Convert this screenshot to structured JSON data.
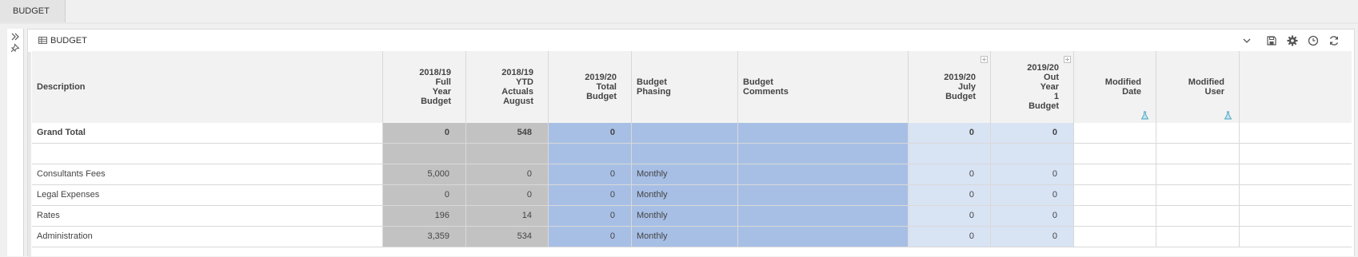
{
  "tab": {
    "label": "BUDGET"
  },
  "panel": {
    "title": "BUDGET"
  },
  "colors": {
    "actuals_bg": "#c2c2c2",
    "phasing_bg": "#a7bfe5",
    "projection_bg": "#d8e3f4",
    "header_bg": "#f2f2f2"
  },
  "columns": [
    {
      "label": "Description"
    },
    {
      "label": "2018/19\nFull\nYear\nBudget"
    },
    {
      "label": "2018/19\nYTD\nActuals\nAugust"
    },
    {
      "label": "2019/20\nTotal\nBudget"
    },
    {
      "label": "Budget\nPhasing"
    },
    {
      "label": "Budget\nComments"
    },
    {
      "label": "2019/20\nJuly\nBudget"
    },
    {
      "label": "2019/20\nOut\nYear\n1\nBudget"
    },
    {
      "label": "Modified\nDate"
    },
    {
      "label": "Modified\nUser"
    }
  ],
  "rows": [
    {
      "cells": [
        "Grand Total",
        "0",
        "548",
        "0",
        "",
        "",
        "0",
        "0",
        "",
        ""
      ]
    },
    {
      "cells": [
        "",
        "",
        "",
        "",
        "",
        "",
        "",
        "",
        "",
        ""
      ]
    },
    {
      "cells": [
        "Consultants Fees",
        "5,000",
        "0",
        "0",
        "Monthly",
        "",
        "0",
        "0",
        "",
        ""
      ]
    },
    {
      "cells": [
        "Legal Expenses",
        "0",
        "0",
        "0",
        "Monthly",
        "",
        "0",
        "0",
        "",
        ""
      ]
    },
    {
      "cells": [
        "Rates",
        "196",
        "14",
        "0",
        "Monthly",
        "",
        "0",
        "0",
        "",
        ""
      ]
    },
    {
      "cells": [
        "Administration",
        "3,359",
        "534",
        "0",
        "Monthly",
        "",
        "0",
        "0",
        "",
        ""
      ]
    }
  ],
  "icons": {
    "rail": [
      "expand-icon",
      "pin-icon"
    ],
    "header": [
      "chevron-down-icon",
      "save-icon",
      "gear-icon",
      "clock-icon",
      "refresh-icon"
    ]
  }
}
